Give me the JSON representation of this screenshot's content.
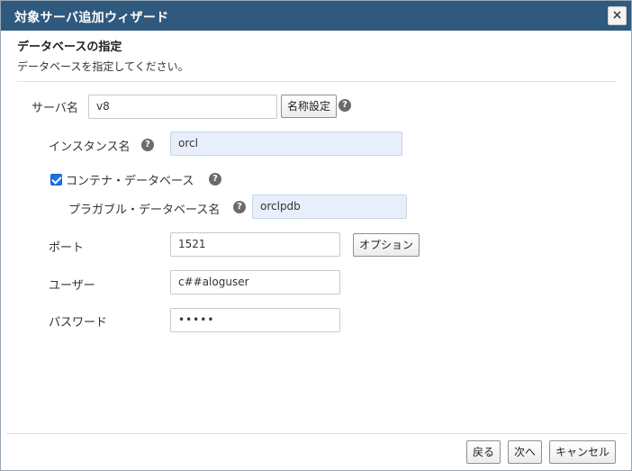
{
  "window": {
    "title": "対象サーバ追加ウィザード",
    "close_label": "×"
  },
  "header": {
    "heading": "データベースの指定",
    "description": "データベースを指定してください。"
  },
  "form": {
    "server_name": {
      "label": "サーバ名",
      "value": "v8",
      "button": "名称設定"
    },
    "instance_name": {
      "label": "インスタンス名",
      "value": "orcl"
    },
    "container_db": {
      "label": "コンテナ・データベース",
      "checked": true
    },
    "pluggable_db": {
      "label": "プラガブル・データベース名",
      "value": "orclpdb"
    },
    "port": {
      "label": "ポート",
      "value": "1521",
      "button": "オプション"
    },
    "user": {
      "label": "ユーザー",
      "value": "c##aloguser"
    },
    "password": {
      "label": "パスワード",
      "value": "•••••"
    }
  },
  "footer": {
    "back": "戻る",
    "next": "次へ",
    "cancel": "キャンセル"
  },
  "help_glyph": "?",
  "colors": {
    "titlebar": "#2f5a7e",
    "checkbox": "#1a73e8",
    "field_highlight": "#e8effb"
  }
}
